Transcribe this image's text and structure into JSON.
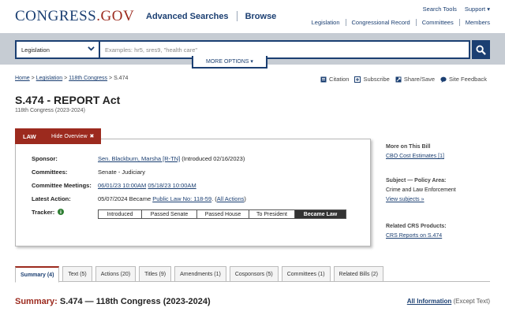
{
  "header": {
    "logo": {
      "part1": "CONGRESS",
      "dot": ".",
      "part2": "GOV"
    },
    "nav": [
      "Advanced Searches",
      "Browse"
    ],
    "utility": [
      "Search Tools",
      "Support ▾"
    ],
    "subnav": [
      "Legislation",
      "Congressional Record",
      "Committees",
      "Members"
    ]
  },
  "search": {
    "collection": "Legislation",
    "placeholder": "Examples: hr5, sres9, \"health care\"",
    "more_options": "MORE OPTIONS ▾"
  },
  "breadcrumb": {
    "home": "Home",
    "sep": ">",
    "legislation": "Legislation",
    "congress": "118th Congress",
    "current": "S.474"
  },
  "tools": [
    "Citation",
    "Subscribe",
    "Share/Save",
    "Site Feedback"
  ],
  "bill": {
    "title": "S.474 - REPORT Act",
    "congress": "118th Congress (2023-2024)"
  },
  "overview": {
    "status_tab": "LAW",
    "hide_label": "Hide Overview",
    "hide_x": "✖",
    "sponsor_label": "Sponsor:",
    "sponsor_link": "Sen. Blackburn, Marsha [R-TN]",
    "sponsor_date": " (Introduced 02/16/2023)",
    "committees_label": "Committees:",
    "committees_value": "Senate - Judiciary",
    "meetings_label": "Committee Meetings:",
    "meetings": [
      "06/01/23 10:00AM",
      "05/18/23 10:00AM"
    ],
    "latest_label": "Latest Action:",
    "latest_text": "05/07/2024 Became ",
    "latest_link": "Public Law No: 118-59",
    "latest_sep": ".  (",
    "all_actions": "All Actions",
    "latest_close": ")",
    "tracker_label": "Tracker:",
    "tracker_stages": [
      "Introduced",
      "Passed Senate",
      "Passed House",
      "To President",
      "Became Law"
    ]
  },
  "sidebar": {
    "more_title": "More on This Bill",
    "more_link": "CBO Cost Estimates [1]",
    "subject_title": "Subject — Policy Area:",
    "subject_value": "Crime and Law Enforcement",
    "subject_link": "View subjects »",
    "related_title": "Related CRS Products:",
    "related_link": "CRS Reports on S.474"
  },
  "tabs": [
    "Summary (4)",
    "Text (5)",
    "Actions (20)",
    "Titles (9)",
    "Amendments (1)",
    "Cosponsors (5)",
    "Committees (1)",
    "Related Bills (2)"
  ],
  "summary": {
    "prefix": "Summary:",
    "heading": " S.474 — 118th Congress (2023-2024)",
    "all_info": "All Information",
    "except_text": " (Except Text)"
  },
  "colors": {
    "navy": "#1b3f72",
    "brand_red": "#9c2a1e",
    "band": "#c6ccd3"
  }
}
